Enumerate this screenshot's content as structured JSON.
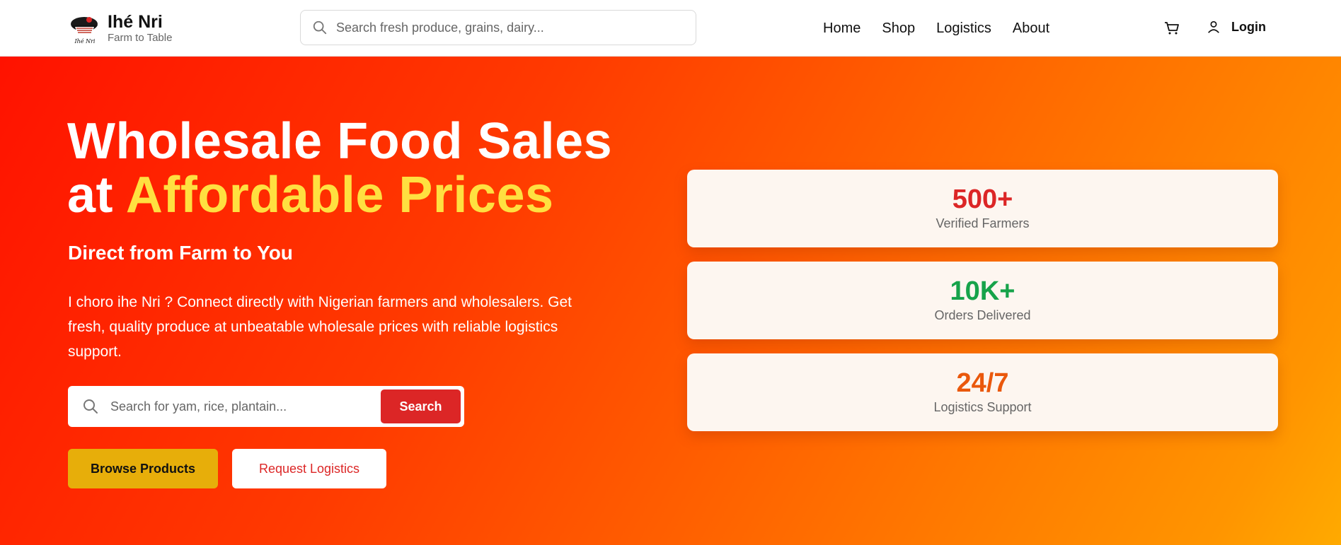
{
  "header": {
    "brand_name": "Ihé Nri",
    "brand_tagline": "Farm to Table",
    "logo_script": "Ihé Nri",
    "search_placeholder": "Search fresh produce, grains, dairy...",
    "nav": [
      "Home",
      "Shop",
      "Logistics",
      "About"
    ],
    "login_label": "Login"
  },
  "hero": {
    "title_line1": "Wholesale Food Sales",
    "title_line2_prefix": "at ",
    "title_line2_highlight": "Affordable Prices",
    "subtitle": "Direct from Farm to You",
    "description": "I choro ihe Nri ? Connect directly with Nigerian farmers and wholesalers. Get fresh, quality produce at unbeatable wholesale prices with reliable logistics support.",
    "search_placeholder": "Search for yam, rice, plantain...",
    "search_button": "Search",
    "browse_button": "Browse Products",
    "logistics_button": "Request Logistics"
  },
  "stats": [
    {
      "value": "500+",
      "label": "Verified Farmers"
    },
    {
      "value": "10K+",
      "label": "Orders Delivered"
    },
    {
      "value": "24/7",
      "label": "Logistics Support"
    }
  ],
  "colors": {
    "accent_red": "#dc2626",
    "accent_green": "#16a34a",
    "accent_orange": "#ea580c",
    "highlight_yellow": "#ffe040",
    "browse_yellow": "#e7ae0a"
  },
  "icons": [
    "basket-logo",
    "search-icon",
    "cart-icon",
    "user-icon"
  ]
}
